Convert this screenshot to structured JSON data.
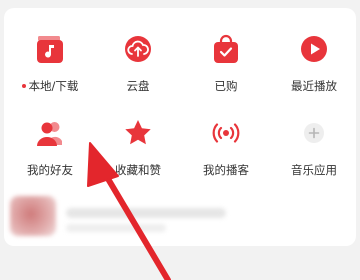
{
  "menu": {
    "items": [
      {
        "label": "本地/下载",
        "icon": "music-note-icon",
        "has_dot": true
      },
      {
        "label": "云盘",
        "icon": "cloud-upload-icon",
        "has_dot": false
      },
      {
        "label": "已购",
        "icon": "shopping-bag-check-icon",
        "has_dot": false
      },
      {
        "label": "最近播放",
        "icon": "play-circle-icon",
        "has_dot": false
      },
      {
        "label": "我的好友",
        "icon": "friends-icon",
        "has_dot": false
      },
      {
        "label": "收藏和赞",
        "icon": "star-icon",
        "has_dot": false
      },
      {
        "label": "我的播客",
        "icon": "broadcast-icon",
        "has_dot": false
      },
      {
        "label": "音乐应用",
        "icon": "add-icon",
        "has_dot": false
      }
    ]
  },
  "colors": {
    "accent": "#e8353b",
    "label": "#333333",
    "annotation_arrow": "#e3262c",
    "background": "#f2f2f2",
    "card": "#ffffff"
  }
}
